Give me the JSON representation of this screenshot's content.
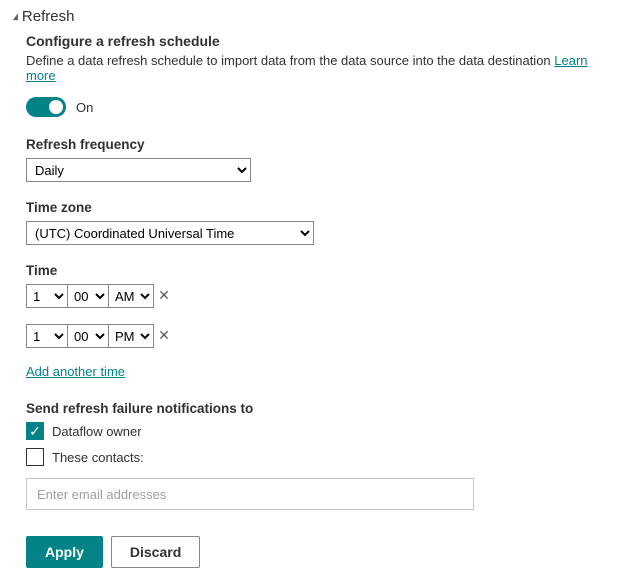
{
  "section": {
    "title": "Refresh",
    "subtitle": "Configure a refresh schedule",
    "description": "Define a data refresh schedule to import data from the data source into the data destination",
    "learn_more": "Learn more"
  },
  "toggle": {
    "on": true,
    "label": "On"
  },
  "frequency": {
    "label": "Refresh frequency",
    "value": "Daily"
  },
  "timezone": {
    "label": "Time zone",
    "value": "(UTC) Coordinated Universal Time"
  },
  "time": {
    "label": "Time",
    "rows": [
      {
        "hour": "1",
        "minute": "00",
        "ampm": "AM"
      },
      {
        "hour": "1",
        "minute": "00",
        "ampm": "PM"
      }
    ],
    "add_another": "Add another time"
  },
  "notifications": {
    "label": "Send refresh failure notifications to",
    "owner_label": "Dataflow owner",
    "owner_checked": true,
    "contacts_label": "These contacts:",
    "contacts_checked": false,
    "email_placeholder": "Enter email addresses"
  },
  "buttons": {
    "apply": "Apply",
    "discard": "Discard"
  }
}
